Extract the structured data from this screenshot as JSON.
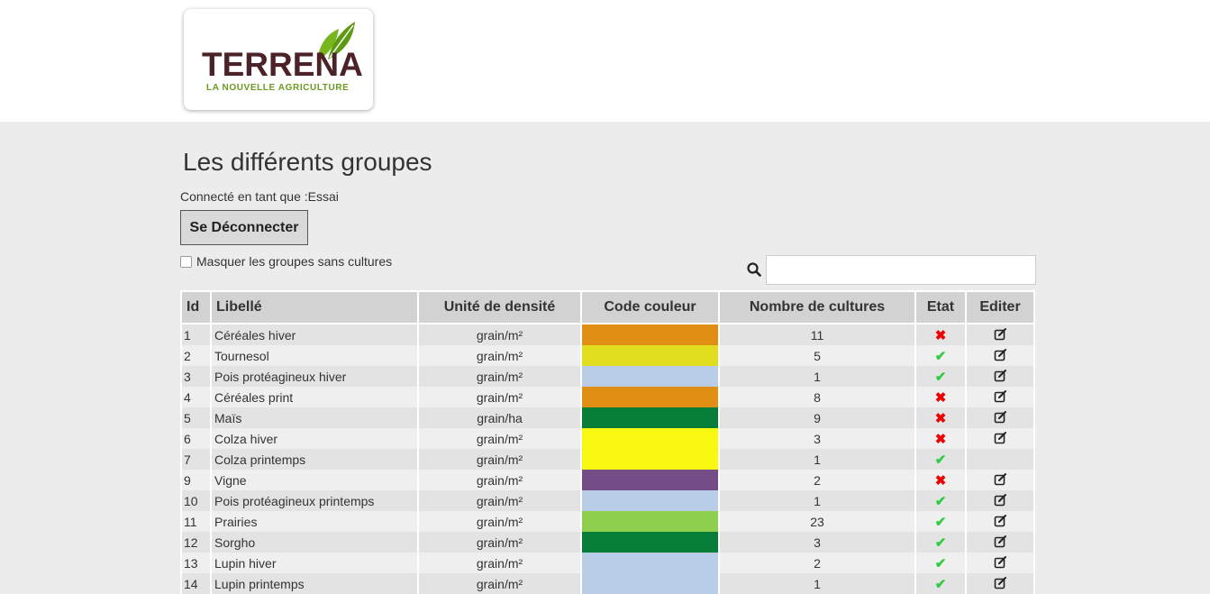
{
  "brand": {
    "name": "TERRENA",
    "tagline": "LA NOUVELLE AGRICULTURE",
    "word_color": "#4a2228",
    "tag_color": "#6a9a1f"
  },
  "page": {
    "title": "Les différents groupes",
    "connected_text": "Connecté en tant que :Essai",
    "logout_label": "Se Déconnecter",
    "mask_label": "Masquer les groupes sans cultures",
    "mask_checked": false,
    "search_value": "",
    "search_icon": "search-icon"
  },
  "table": {
    "headers": [
      "Id",
      "Libellé",
      "Unité de densité",
      "Code couleur",
      "Nombre de cultures",
      "Etat",
      "Editer"
    ],
    "rows": [
      {
        "id": "1",
        "label": "Céréales hiver",
        "unit": "grain/m²",
        "color": "#e08e14",
        "count": "11",
        "etat": "ko",
        "edit": true
      },
      {
        "id": "2",
        "label": "Tournesol",
        "unit": "grain/m²",
        "color": "#e0de1f",
        "count": "5",
        "etat": "ok",
        "edit": true
      },
      {
        "id": "3",
        "label": "Pois protéagineux hiver",
        "unit": "grain/m²",
        "color": "#b9cde6",
        "count": "1",
        "etat": "ok",
        "edit": true
      },
      {
        "id": "4",
        "label": "Céréales print",
        "unit": "grain/m²",
        "color": "#e08e14",
        "count": "8",
        "etat": "ko",
        "edit": true
      },
      {
        "id": "5",
        "label": "Maïs",
        "unit": "grain/ha",
        "color": "#077e37",
        "count": "9",
        "etat": "ko",
        "edit": true
      },
      {
        "id": "6",
        "label": "Colza hiver",
        "unit": "grain/m²",
        "color": "#f8f811",
        "count": "3",
        "etat": "ko",
        "edit": true
      },
      {
        "id": "7",
        "label": "Colza printemps",
        "unit": "grain/m²",
        "color": "#f8f811",
        "count": "1",
        "etat": "ok",
        "edit": false
      },
      {
        "id": "9",
        "label": "Vigne",
        "unit": "grain/m²",
        "color": "#744d86",
        "count": "2",
        "etat": "ko",
        "edit": true
      },
      {
        "id": "10",
        "label": "Pois protéagineux printemps",
        "unit": "grain/m²",
        "color": "#b9cde6",
        "count": "1",
        "etat": "ok",
        "edit": true
      },
      {
        "id": "11",
        "label": "Prairies",
        "unit": "grain/m²",
        "color": "#8ecf4d",
        "count": "23",
        "etat": "ok",
        "edit": true
      },
      {
        "id": "12",
        "label": "Sorgho",
        "unit": "grain/m²",
        "color": "#077e37",
        "count": "3",
        "etat": "ok",
        "edit": true
      },
      {
        "id": "13",
        "label": "Lupin hiver",
        "unit": "grain/m²",
        "color": "#b9cde6",
        "count": "2",
        "etat": "ok",
        "edit": true
      },
      {
        "id": "14",
        "label": "Lupin printemps",
        "unit": "grain/m²",
        "color": "#b9cde6",
        "count": "1",
        "etat": "ok",
        "edit": true
      }
    ]
  },
  "symbols": {
    "ok": "✔",
    "ko": "✖"
  },
  "colors": {
    "ok": "#2ecc40",
    "ko": "#e00000",
    "header_bg": "#d2d2d2",
    "page_bg": "#ececec"
  }
}
